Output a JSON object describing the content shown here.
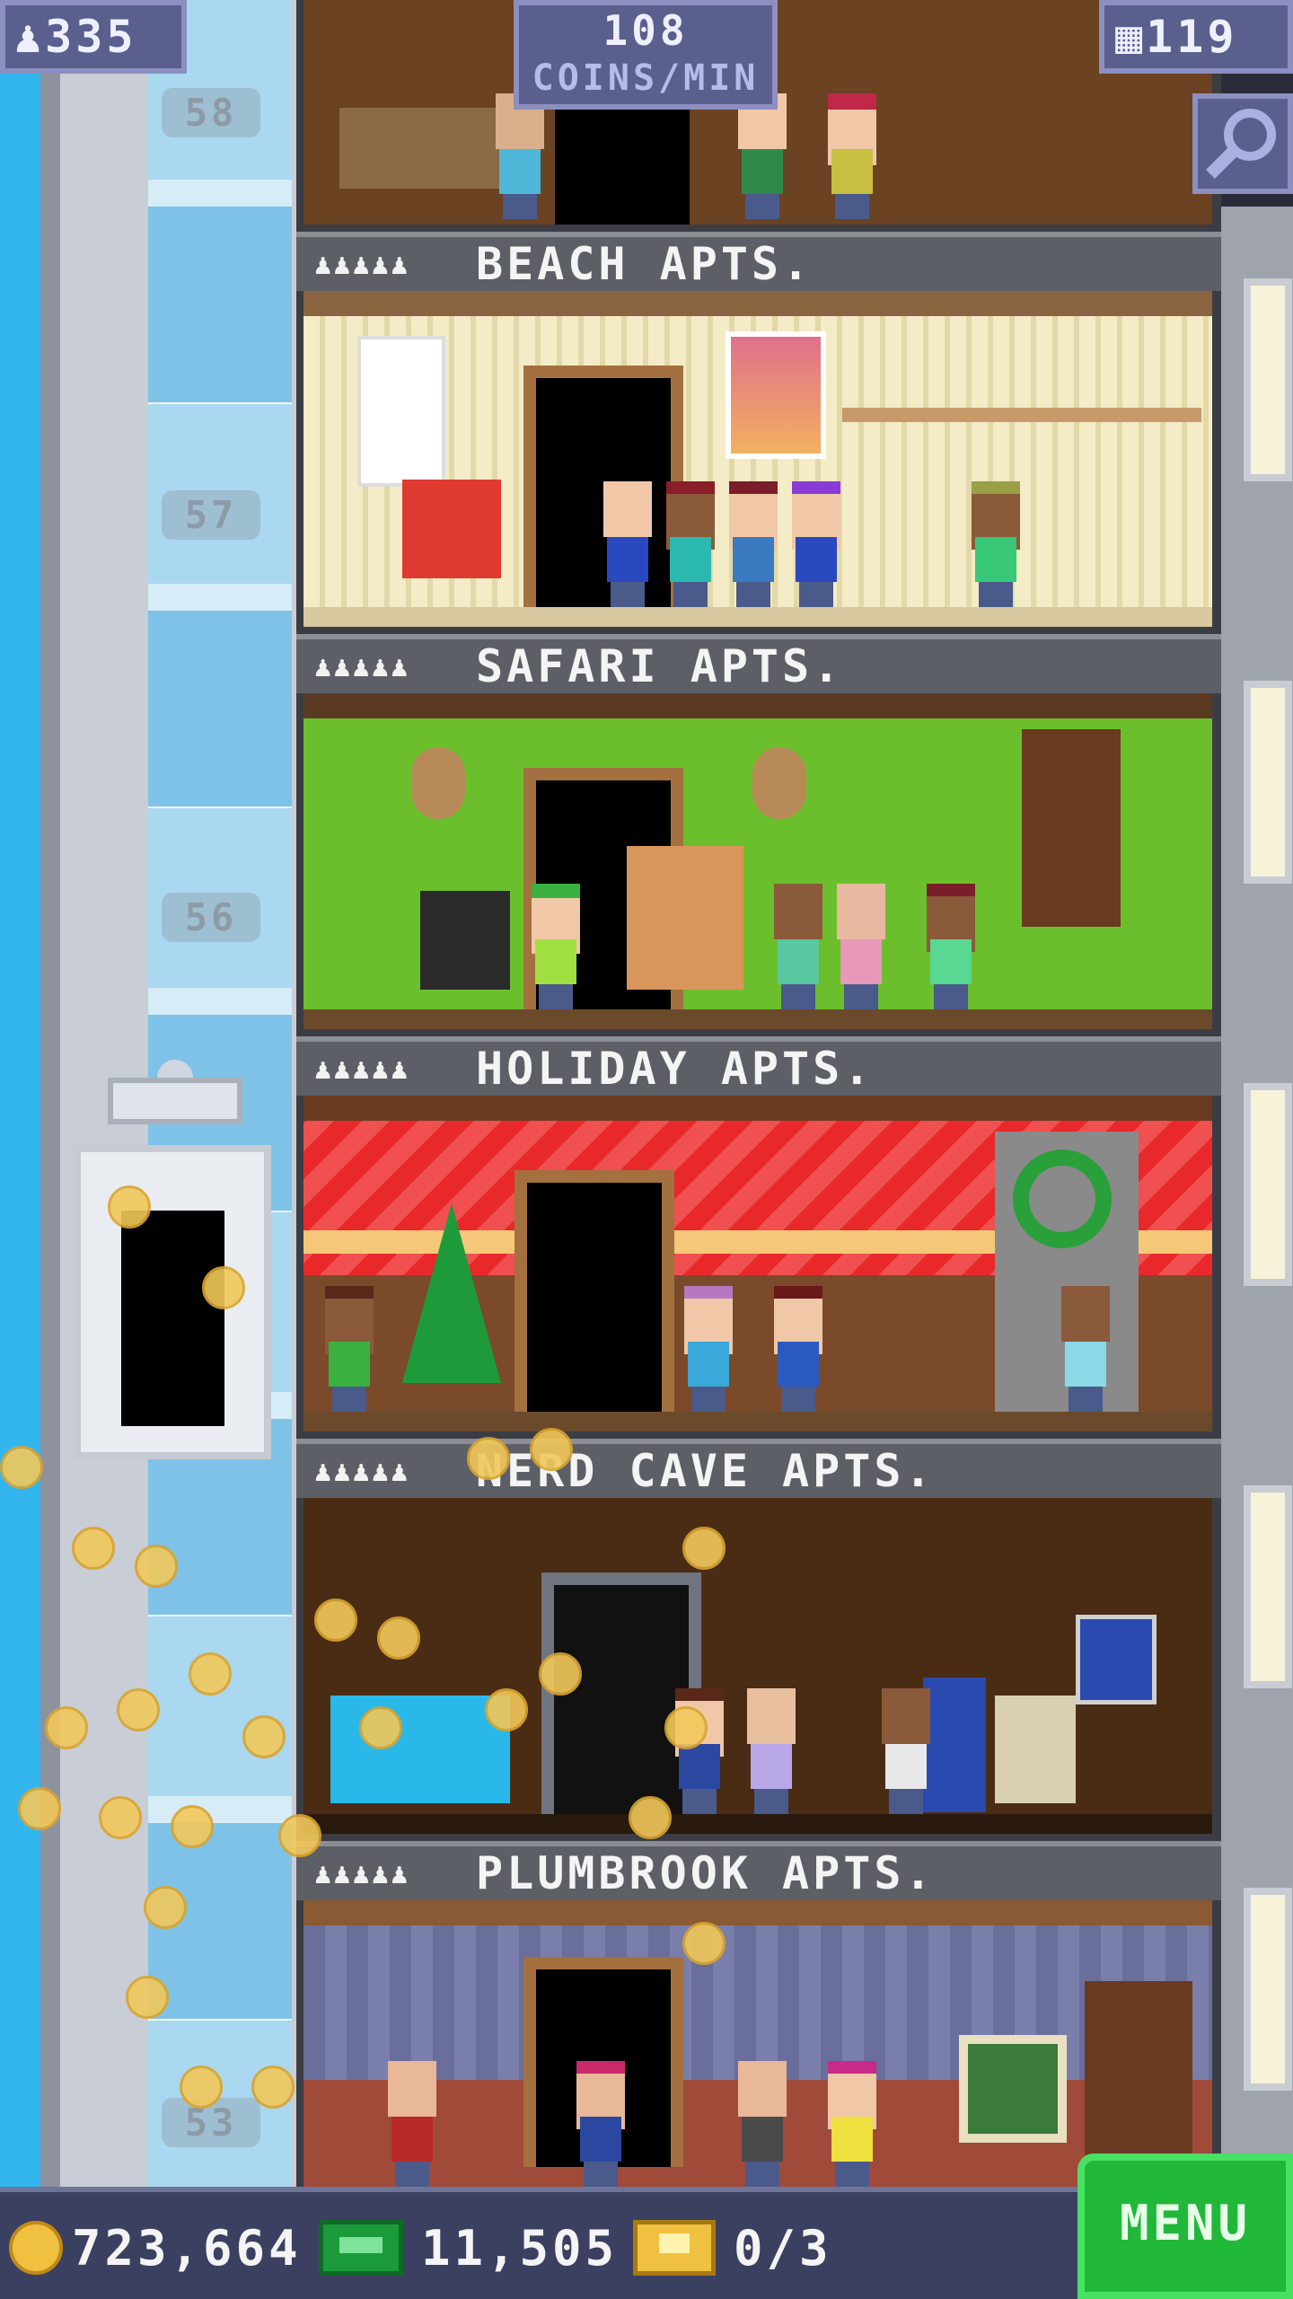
{
  "hud": {
    "population": "335",
    "coin_rate_value": "108",
    "coin_rate_unit": "COINS/MIN",
    "floor_count": "119"
  },
  "shaft": {
    "floor_numbers": [
      "58",
      "57",
      "56",
      "53"
    ]
  },
  "floors": [
    {
      "stars": "♟♟♟♟♟",
      "name": "BEACH APTS."
    },
    {
      "stars": "♟♟♟♟♟",
      "name": "SAFARI APTS."
    },
    {
      "stars": "♟♟♟♟♟",
      "name": "HOLIDAY APTS."
    },
    {
      "stars": "♟♟♟♟♟",
      "name": "NERD CAVE APTS."
    },
    {
      "stars": "♟♟♟♟♟",
      "name": "PLUMBROOK APTS."
    }
  ],
  "bottom": {
    "coins": "723,664",
    "bux": "11,505",
    "tickets": "0/3",
    "menu_label": "MENU"
  },
  "colors": {
    "sky": "#33b6ee",
    "hud_bg": "#5b5f8e",
    "menu_green": "#21b83a",
    "coin_gold": "#f0c040"
  }
}
